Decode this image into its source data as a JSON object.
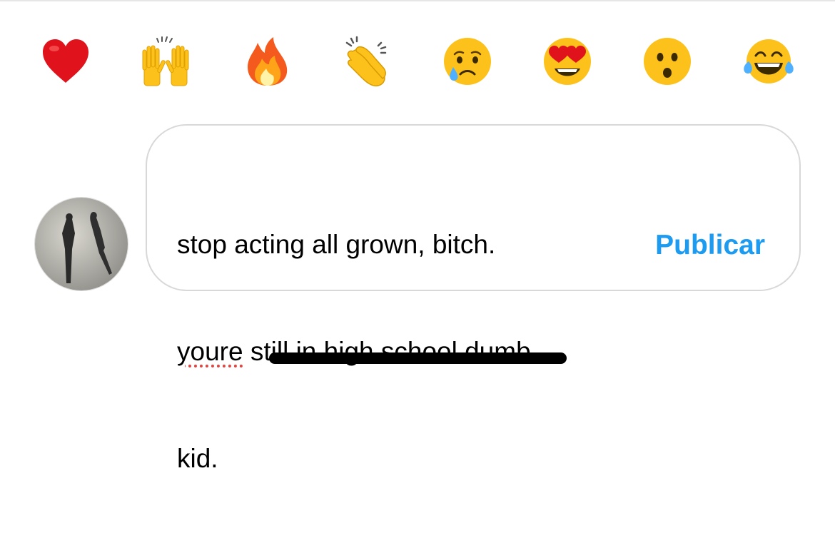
{
  "reactions": [
    {
      "icon": "red-heart-icon"
    },
    {
      "icon": "raising-hands-icon"
    },
    {
      "icon": "fire-icon"
    },
    {
      "icon": "clapping-hands-icon"
    },
    {
      "icon": "crying-face-icon"
    },
    {
      "icon": "heart-eyes-face-icon"
    },
    {
      "icon": "surprised-face-icon"
    },
    {
      "icon": "tears-of-joy-face-icon"
    }
  ],
  "comment": {
    "line1": "stop acting all grown, bitch.",
    "line2_misspelled": "youre",
    "line2_rest": " still in high school dumb",
    "line3": "kid."
  },
  "publish_label": "Publicar",
  "colors": {
    "accent": "#1d9bf0",
    "box_border": "#d8d8d8",
    "spellcheck_underline": "#e0443e"
  }
}
